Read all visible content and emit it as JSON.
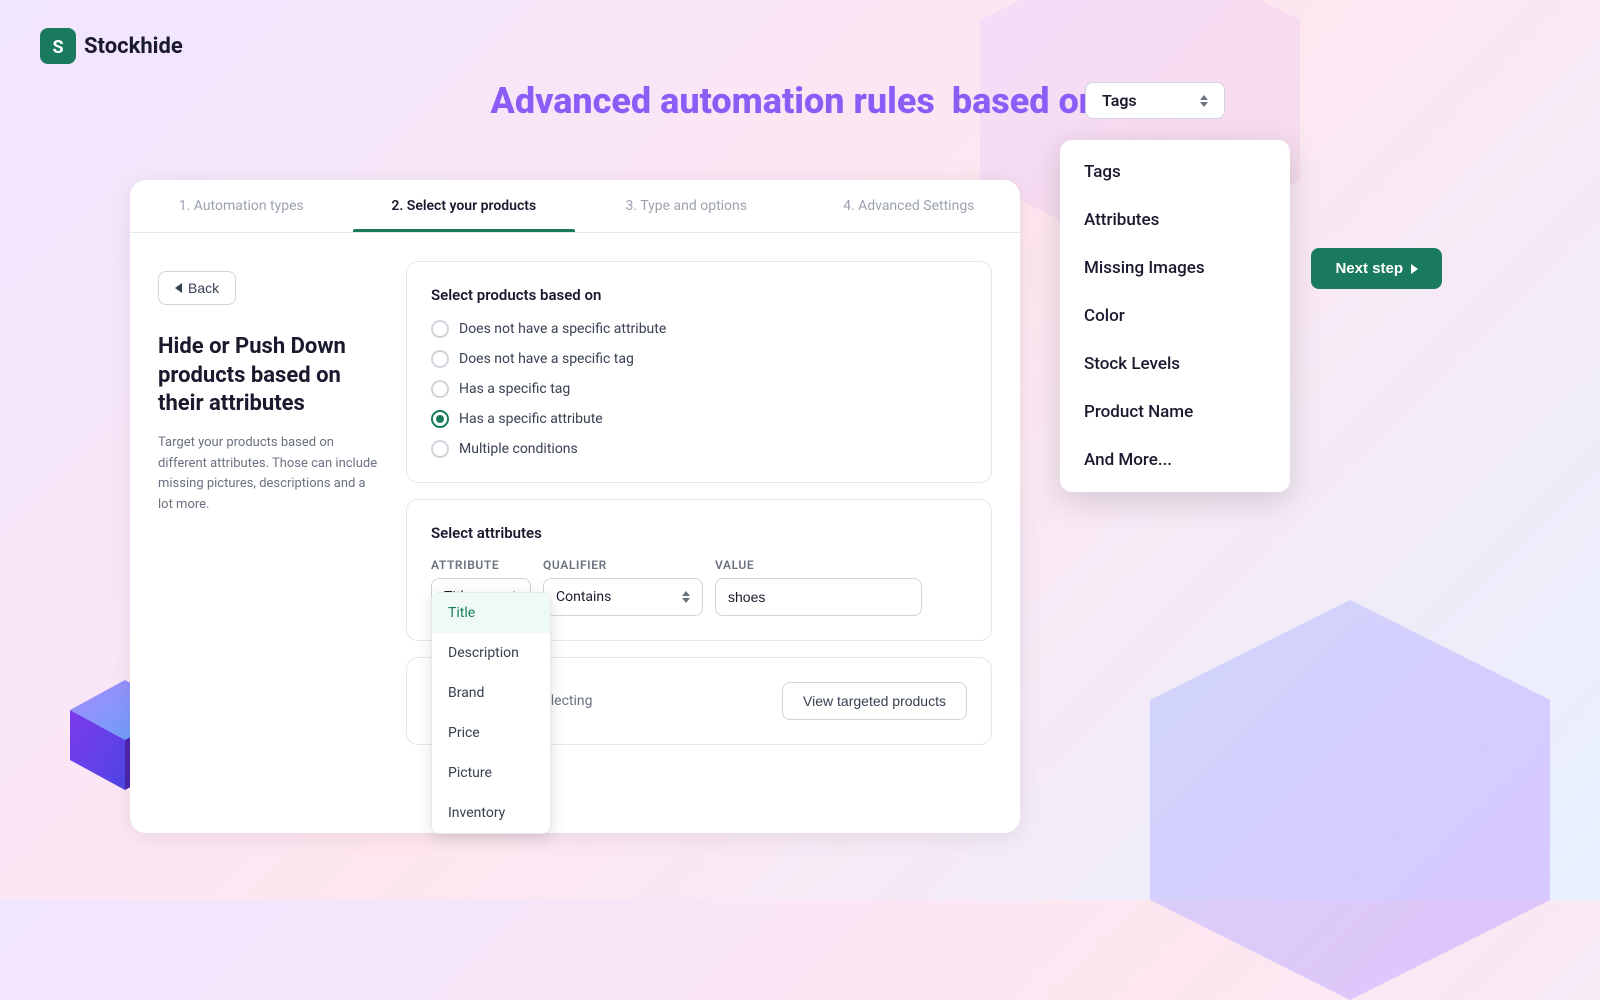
{
  "logo": {
    "text": "Stockhide"
  },
  "heading": {
    "prefix": "Advanced automation rules",
    "highlight": "based on:",
    "dropdown_value": "Tags"
  },
  "dropdown_menu": {
    "items": [
      "Tags",
      "Attributes",
      "Missing Images",
      "Color",
      "Stock Levels",
      "Product Name",
      "And More..."
    ]
  },
  "steps": [
    {
      "label": "1. Automation types",
      "active": false
    },
    {
      "label": "2. Select your products",
      "active": true
    },
    {
      "label": "3. Type and options",
      "active": false
    },
    {
      "label": "4. Advanced Settings",
      "active": false
    }
  ],
  "back_button": "Back",
  "next_button": "Next step",
  "left_panel": {
    "title": "Hide or Push Down products based on their attributes",
    "description": "Target your products based on different attributes. Those can include missing pictures, descriptions and a lot more."
  },
  "select_products": {
    "section_title": "Select products based on",
    "options": [
      {
        "label": "Does not have a specific attribute",
        "selected": false
      },
      {
        "label": "Does not have a specific tag",
        "selected": false
      },
      {
        "label": "Has a specific tag",
        "selected": false
      },
      {
        "label": "Has a specific attribute",
        "selected": true
      },
      {
        "label": "Multiple conditions",
        "selected": false
      }
    ]
  },
  "select_attributes": {
    "section_title": "Select attributes",
    "attribute_label": "Attribute",
    "qualifier_label": "Qualifier",
    "value_label": "Value",
    "attribute_value": "Title",
    "qualifier_value": "Contains",
    "value_input": "shoes",
    "attribute_options": [
      "Title",
      "Description",
      "Brand",
      "Price",
      "Picture",
      "Inventory"
    ]
  },
  "bottom_section": {
    "targeting_text": "Your targeting is selecting",
    "view_button": "View targeted products"
  }
}
